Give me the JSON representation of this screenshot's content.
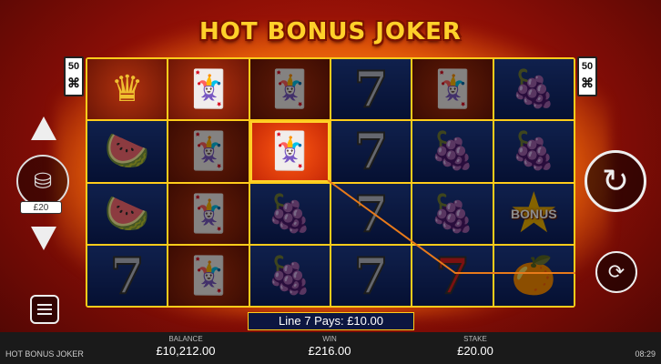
{
  "game": {
    "title": "HOT BONUS JOKER",
    "lines_left": "50",
    "lines_right": "50",
    "pays_text": "Line 7 Pays: £10.00"
  },
  "reels": [
    [
      "crown",
      "watermelon",
      "watermelon",
      "seven"
    ],
    [
      "joker",
      "joker",
      "joker",
      "joker"
    ],
    [
      "joker",
      "joker-highlight",
      "grapes",
      "grapes"
    ],
    [
      "seven",
      "seven",
      "seven",
      "seven"
    ],
    [
      "joker",
      "grapes",
      "grapes",
      "seven-red"
    ],
    [
      "grapes",
      "grapes",
      "bonus",
      "orange"
    ]
  ],
  "bonus_label": "BONUS",
  "controls": {
    "stake_value": "£20",
    "spin_icon": "spin-arrow-icon",
    "autoplay_icon": "autoplay-icon",
    "menu_icon": "menu-icon"
  },
  "footer": {
    "game_name": "HOT BONUS JOKER",
    "balance_label": "BALANCE",
    "balance_value": "£10,212.00",
    "win_label": "WIN",
    "win_value": "£216.00",
    "stake_label": "STAKE",
    "stake_value": "£20.00",
    "clock": "08:29"
  },
  "colors": {
    "frame": "#ffcc1a",
    "background": "#8a0e06",
    "payline": "#e87a1a"
  }
}
